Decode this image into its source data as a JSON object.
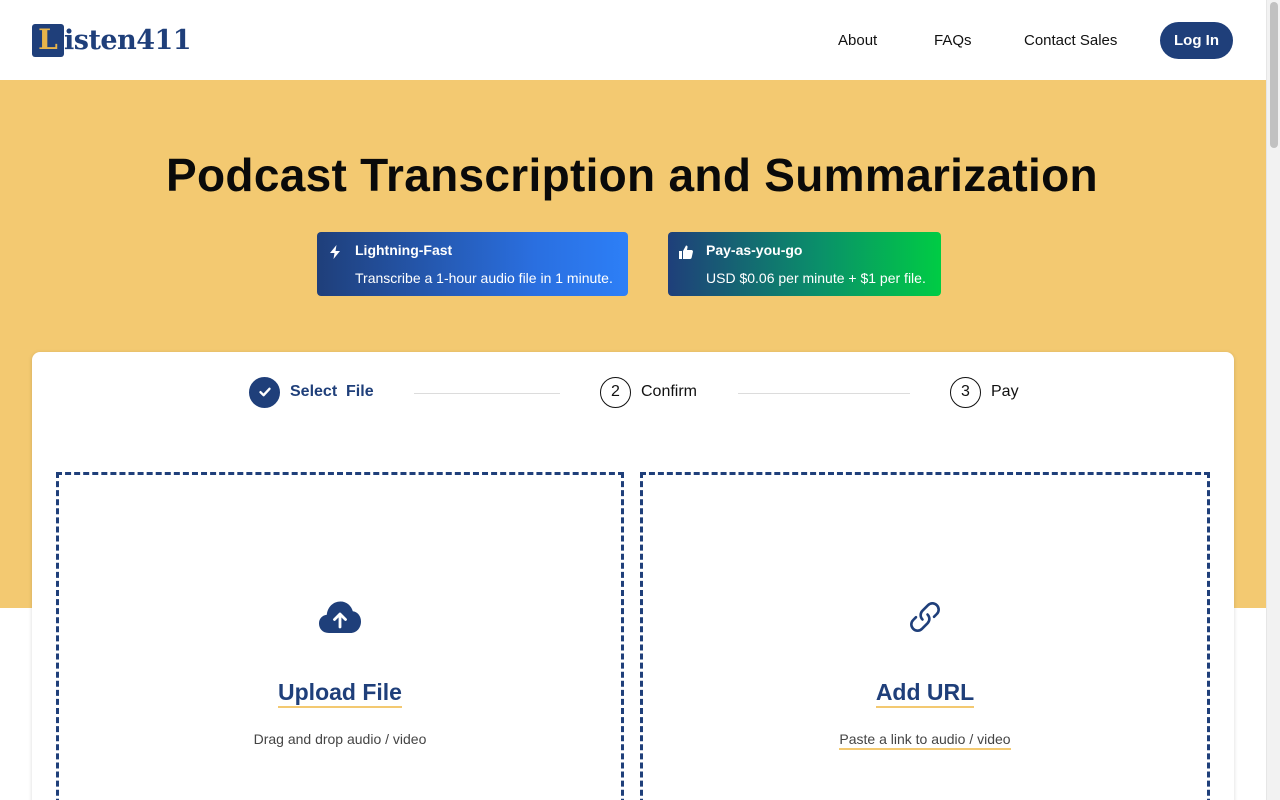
{
  "header": {
    "logo_initial": "L",
    "logo_rest": "isten411",
    "nav": {
      "about": "About",
      "faqs": "FAQs",
      "contact_sales": "Contact Sales"
    },
    "login_label": "Log In"
  },
  "hero": {
    "title": "Podcast Transcription and Summarization",
    "features": [
      {
        "icon": "lightning-icon",
        "title": "Lightning-Fast",
        "description": "Transcribe a 1-hour audio file in 1 minute."
      },
      {
        "icon": "thumbs-up-icon",
        "title": "Pay-as-you-go",
        "description": "USD $0.06 per minute + $1 per file."
      }
    ]
  },
  "steps": [
    {
      "number": "",
      "label": "Select  File",
      "state": "completed"
    },
    {
      "number": "2",
      "label": "Confirm",
      "state": "pending"
    },
    {
      "number": "3",
      "label": "Pay",
      "state": "pending"
    }
  ],
  "upload": {
    "title": "Upload File",
    "subtitle": "Drag and drop audio / video",
    "icon": "cloud-upload-icon"
  },
  "url": {
    "title": "Add URL",
    "subtitle": "Paste a link to audio / video",
    "icon": "link-icon"
  },
  "colors": {
    "brand": "#1f3f7a",
    "hero_background": "#f3c971",
    "accent_underline": "#f3c971"
  }
}
